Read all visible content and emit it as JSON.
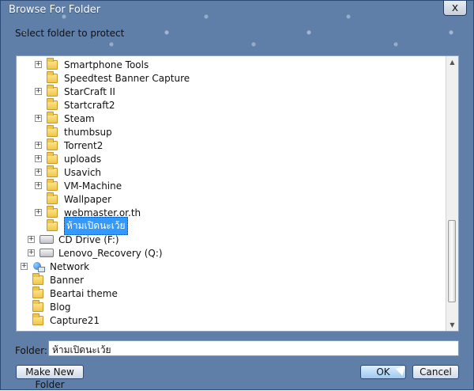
{
  "dialog": {
    "title": "Browse For Folder",
    "close_label": "x",
    "instruction": "Select folder to protect",
    "folder_label": "Folder:",
    "folder_value": "ห้ามเปิดนะเว้ย",
    "buttons": {
      "make_new_folder": "Make New Folder",
      "ok": "OK",
      "cancel": "Cancel"
    }
  },
  "tree": {
    "items": [
      {
        "label": "Smartphone Tools",
        "level": 2,
        "expander": "+",
        "icon": "folder-icon"
      },
      {
        "label": "Speedtest Banner Capture",
        "level": 2,
        "expander": "",
        "icon": "folder-icon"
      },
      {
        "label": "StarCraft II",
        "level": 2,
        "expander": "+",
        "icon": "folder-icon"
      },
      {
        "label": "Startcraft2",
        "level": 2,
        "expander": "",
        "icon": "folder-icon"
      },
      {
        "label": "Steam",
        "level": 2,
        "expander": "+",
        "icon": "folder-icon"
      },
      {
        "label": "thumbsup",
        "level": 2,
        "expander": "",
        "icon": "folder-icon"
      },
      {
        "label": "Torrent2",
        "level": 2,
        "expander": "+",
        "icon": "folder-icon"
      },
      {
        "label": "uploads",
        "level": 2,
        "expander": "+",
        "icon": "folder-icon"
      },
      {
        "label": "Usavich",
        "level": 2,
        "expander": "+",
        "icon": "folder-icon"
      },
      {
        "label": "VM-Machine",
        "level": 2,
        "expander": "+",
        "icon": "folder-icon"
      },
      {
        "label": "Wallpaper",
        "level": 2,
        "expander": "",
        "icon": "folder-icon"
      },
      {
        "label": "webmaster.or.th",
        "level": 2,
        "expander": "+",
        "icon": "folder-icon"
      },
      {
        "label": "ห้ามเปิดนะเว้ย",
        "level": 2,
        "expander": "",
        "icon": "folder-icon",
        "selected": true
      },
      {
        "label": "CD Drive (F:)",
        "level": 1,
        "expander": "+",
        "icon": "drive-icon"
      },
      {
        "label": "Lenovo_Recovery (Q:)",
        "level": 1,
        "expander": "+",
        "icon": "drive-icon"
      },
      {
        "label": "Network",
        "level": 0,
        "expander": "+",
        "icon": "network-icon"
      },
      {
        "label": "Banner",
        "level": 0,
        "expander": "",
        "icon": "folder-icon"
      },
      {
        "label": "Beartai theme",
        "level": 0,
        "expander": "",
        "icon": "folder-icon"
      },
      {
        "label": "Blog",
        "level": 0,
        "expander": "",
        "icon": "folder-icon"
      },
      {
        "label": "Capture21",
        "level": 0,
        "expander": "",
        "icon": "folder-icon"
      }
    ]
  },
  "scrollbar": {
    "up_icon": "scroll-up-icon",
    "down_icon": "scroll-down-icon"
  }
}
